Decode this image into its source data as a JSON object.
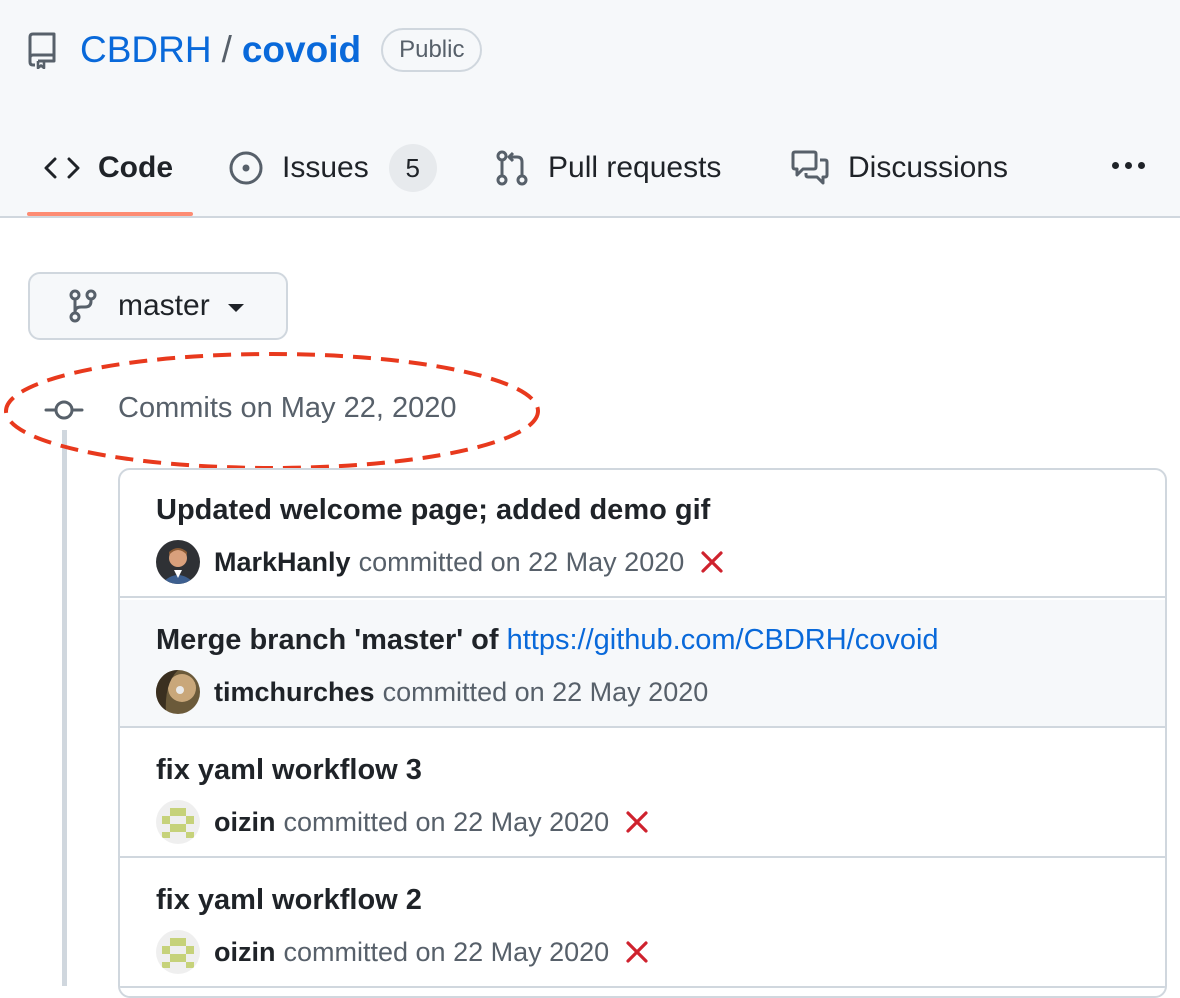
{
  "repo": {
    "owner": "CBDRH",
    "separator": "/",
    "name": "covoid",
    "visibility": "Public",
    "icon": "repo-icon"
  },
  "tabs": [
    {
      "label": "Code",
      "icon": "code-icon",
      "selected": true
    },
    {
      "label": "Issues",
      "icon": "issue-opened-icon",
      "count": "5"
    },
    {
      "label": "Pull requests",
      "icon": "git-pull-request-icon"
    },
    {
      "label": "Discussions",
      "icon": "comment-discussion-icon"
    }
  ],
  "more_icon": "kebab-horizontal-icon",
  "branch": {
    "name": "master",
    "icon": "git-branch-icon"
  },
  "commit_group": {
    "date_label": "Commits on May 22, 2020",
    "icon": "git-commit-icon"
  },
  "commits": [
    {
      "message": "Updated welcome page; added demo gif",
      "author": "MarkHanly",
      "date_text": "committed on 22 May 2020",
      "status": "failure"
    },
    {
      "message_prefix": "Merge branch 'master' of ",
      "message_link": "https://github.com/CBDRH/covoid",
      "author": "timchurches",
      "date_text": "committed on 22 May 2020",
      "status": ""
    },
    {
      "message": "fix yaml workflow 3",
      "author": "oizin",
      "date_text": "committed on 22 May 2020",
      "status": "failure"
    },
    {
      "message": "fix yaml workflow 2",
      "author": "oizin",
      "date_text": "committed on 22 May 2020",
      "status": "failure"
    }
  ],
  "colors": {
    "link": "#0969da",
    "failure": "#cf222e",
    "annotation": "#e8391d",
    "tab_underline": "#fd8c73"
  }
}
